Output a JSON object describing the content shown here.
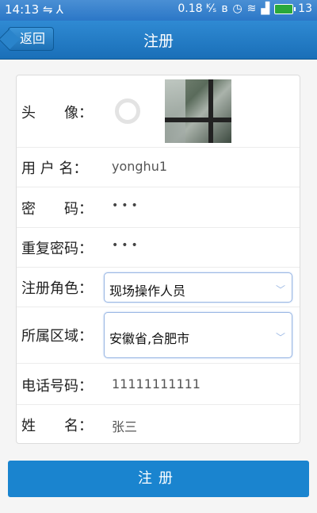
{
  "status_bar": {
    "time": "14:13",
    "left_icons": [
      "usb-icon",
      "network-icon"
    ],
    "speed": "0.18 ᴷ⁄ₛ",
    "right_icons": [
      "bluetooth-icon",
      "alarm-icon",
      "wifi-icon",
      "signal-icon",
      "battery-icon"
    ],
    "battery": "13"
  },
  "header": {
    "back_label": "返回",
    "title": "注册"
  },
  "form": {
    "avatar": {
      "label": "头　　像："
    },
    "username": {
      "label": "用 户 名：",
      "value": "yonghu1"
    },
    "password": {
      "label": "密　　码：",
      "value": "•••"
    },
    "confirm_password": {
      "label": "重复密码：",
      "value": "•••"
    },
    "role": {
      "label": "注册角色：",
      "selected": "现场操作人员"
    },
    "region": {
      "label": "所属区域：",
      "selected": "安徽省,合肥市"
    },
    "phone": {
      "label": "电话号码：",
      "value": "11111111111"
    },
    "name": {
      "label": "姓　　名：",
      "value": "张三"
    }
  },
  "submit_label": "注册"
}
